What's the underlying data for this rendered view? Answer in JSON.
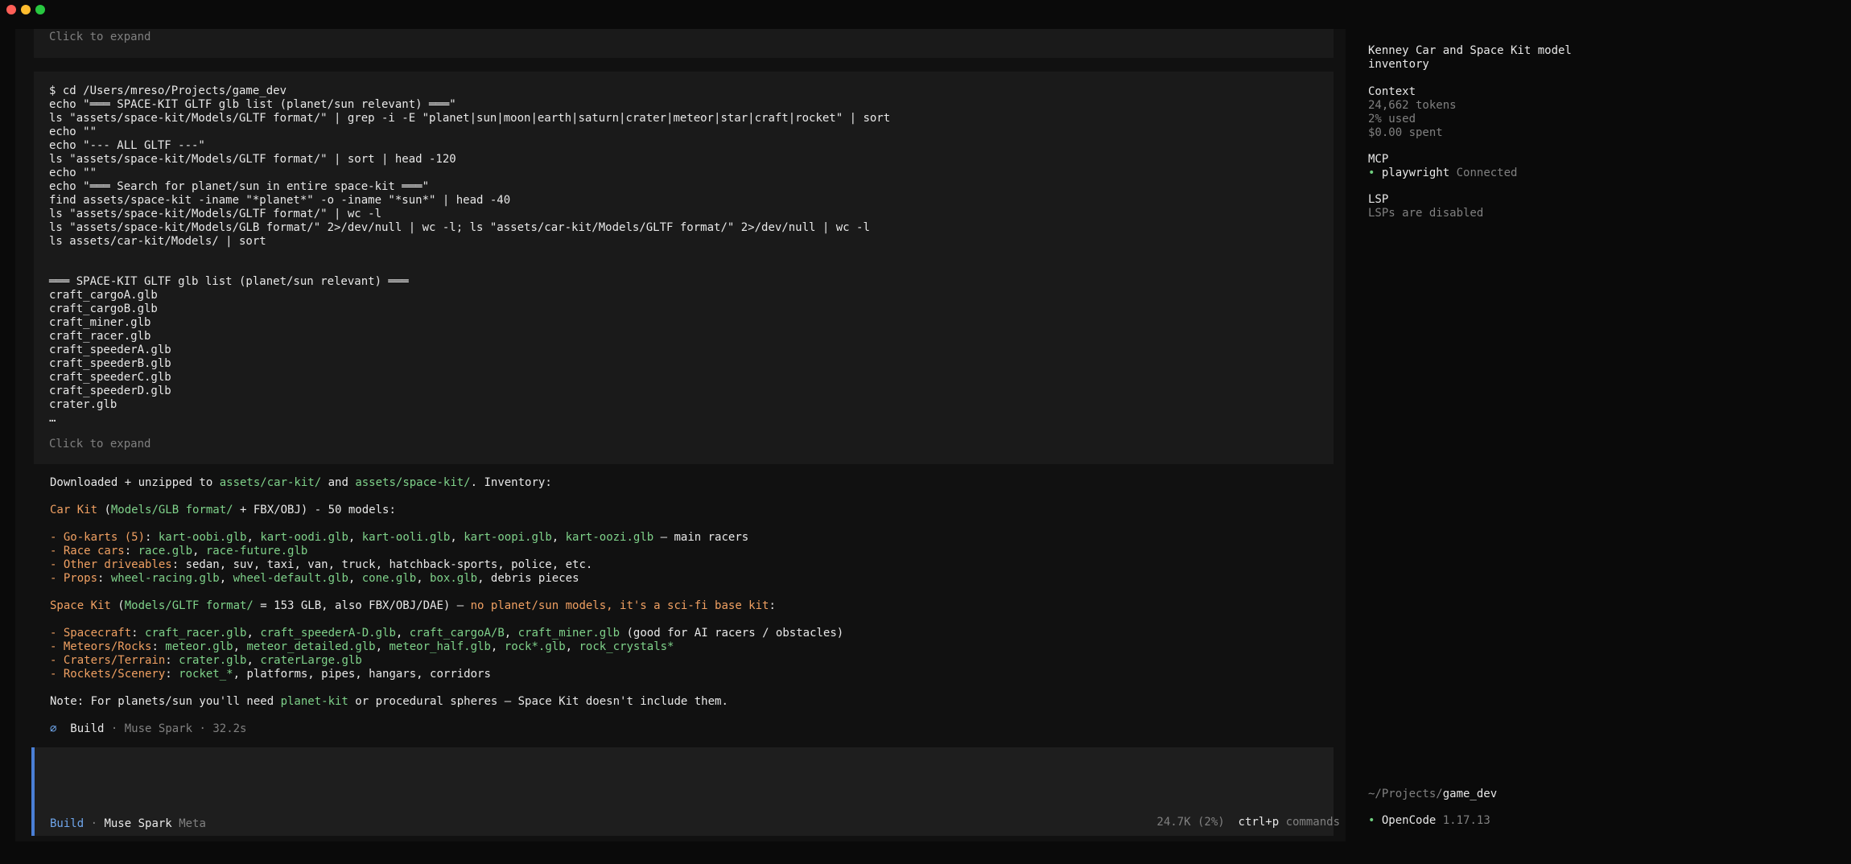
{
  "collapsed_block": {
    "expand_label": "Click to expand"
  },
  "tool_block": {
    "command_lines": [
      "$ cd /Users/mreso/Projects/game_dev",
      "echo \"═══ SPACE-KIT GLTF glb list (planet/sun relevant) ═══\"",
      "ls \"assets/space-kit/Models/GLTF format/\" | grep -i -E \"planet|sun|moon|earth|saturn|crater|meteor|star|craft|rocket\" | sort",
      "echo \"\"",
      "echo \"--- ALL GLTF ---\"",
      "ls \"assets/space-kit/Models/GLTF format/\" | sort | head -120",
      "echo \"\"",
      "echo \"═══ Search for planet/sun in entire space-kit ═══\"",
      "find assets/space-kit -iname \"*planet*\" -o -iname \"*sun*\" | head -40",
      "ls \"assets/space-kit/Models/GLTF format/\" | wc -l",
      "ls \"assets/space-kit/Models/GLB format/\" 2>/dev/null | wc -l; ls \"assets/car-kit/Models/GLTF format/\" 2>/dev/null | wc -l",
      "ls assets/car-kit/Models/ | sort"
    ],
    "output_lines": [
      "═══ SPACE-KIT GLTF glb list (planet/sun relevant) ═══",
      "craft_cargoA.glb",
      "craft_cargoB.glb",
      "craft_miner.glb",
      "craft_racer.glb",
      "craft_speederA.glb",
      "craft_speederB.glb",
      "craft_speederC.glb",
      "craft_speederD.glb",
      "crater.glb",
      "…"
    ],
    "expand_label": "Click to expand"
  },
  "assistant": {
    "intro": {
      "a": "Downloaded + unzipped to ",
      "b": "assets/car-kit/",
      "c": " and ",
      "d": "assets/space-kit/",
      "e": ". Inventory:"
    },
    "car_kit": {
      "title": "Car Kit",
      "a": " (",
      "path": "Models/GLB format/",
      "b": " + FBX/OBJ) - 50 models:"
    },
    "car_items": [
      {
        "label": "- Go-karts (5)",
        "sep": ": ",
        "parts": [
          {
            "t": "kart-oobi.glb",
            "c": "green"
          },
          {
            "t": ", ",
            "c": "white"
          },
          {
            "t": "kart-oodi.glb",
            "c": "green"
          },
          {
            "t": ", ",
            "c": "white"
          },
          {
            "t": "kart-ooli.glb",
            "c": "green"
          },
          {
            "t": ", ",
            "c": "white"
          },
          {
            "t": "kart-oopi.glb",
            "c": "green"
          },
          {
            "t": ", ",
            "c": "white"
          },
          {
            "t": "kart-oozi.glb",
            "c": "green"
          },
          {
            "t": " — main racers",
            "c": "white"
          }
        ]
      },
      {
        "label": "- Race cars",
        "sep": ": ",
        "parts": [
          {
            "t": "race.glb",
            "c": "green"
          },
          {
            "t": ", ",
            "c": "white"
          },
          {
            "t": "race-future.glb",
            "c": "green"
          }
        ]
      },
      {
        "label": "- Other driveables",
        "sep": ": ",
        "parts": [
          {
            "t": "sedan, suv, taxi, van, truck, hatchback-sports, police, etc.",
            "c": "white"
          }
        ]
      },
      {
        "label": "- Props",
        "sep": ": ",
        "parts": [
          {
            "t": "wheel-racing.glb",
            "c": "green"
          },
          {
            "t": ", ",
            "c": "white"
          },
          {
            "t": "wheel-default.glb",
            "c": "green"
          },
          {
            "t": ", ",
            "c": "white"
          },
          {
            "t": "cone.glb",
            "c": "green"
          },
          {
            "t": ", ",
            "c": "white"
          },
          {
            "t": "box.glb",
            "c": "green"
          },
          {
            "t": ", debris pieces",
            "c": "white"
          }
        ]
      }
    ],
    "space_kit": {
      "title": "Space Kit",
      "a": " (",
      "path": "Models/GLTF format/",
      "b": " = 153 GLB, also FBX/OBJ/DAE) — ",
      "warn": "no planet/sun models, it's a sci-fi base kit",
      "c": ":"
    },
    "space_items": [
      {
        "label": "- Spacecraft",
        "sep": ": ",
        "parts": [
          {
            "t": "craft_racer.glb",
            "c": "green"
          },
          {
            "t": ", ",
            "c": "white"
          },
          {
            "t": "craft_speederA-D.glb",
            "c": "green"
          },
          {
            "t": ", ",
            "c": "white"
          },
          {
            "t": "craft_cargoA/B",
            "c": "green"
          },
          {
            "t": ", ",
            "c": "white"
          },
          {
            "t": "craft_miner.glb",
            "c": "green"
          },
          {
            "t": " (good for AI racers / obstacles)",
            "c": "white"
          }
        ]
      },
      {
        "label": "- Meteors/Rocks",
        "sep": ": ",
        "parts": [
          {
            "t": "meteor.glb",
            "c": "green"
          },
          {
            "t": ", ",
            "c": "white"
          },
          {
            "t": "meteor_detailed.glb",
            "c": "green"
          },
          {
            "t": ", ",
            "c": "white"
          },
          {
            "t": "meteor_half.glb",
            "c": "green"
          },
          {
            "t": ", ",
            "c": "white"
          },
          {
            "t": "rock*.glb",
            "c": "green"
          },
          {
            "t": ", ",
            "c": "white"
          },
          {
            "t": "rock_crystals*",
            "c": "green"
          }
        ]
      },
      {
        "label": "- Craters/Terrain",
        "sep": ": ",
        "parts": [
          {
            "t": "crater.glb",
            "c": "green"
          },
          {
            "t": ", ",
            "c": "white"
          },
          {
            "t": "craterLarge.glb",
            "c": "green"
          }
        ]
      },
      {
        "label": "- Rockets/Scenery",
        "sep": ": ",
        "parts": [
          {
            "t": "rocket_*",
            "c": "green"
          },
          {
            "t": ", platforms, pipes, hangars, corridors",
            "c": "white"
          }
        ]
      }
    ],
    "note": {
      "a": "Note: For planets/sun you'll need ",
      "b": "planet-kit",
      "c": " or procedural spheres — Space Kit doesn't include them."
    },
    "footer": {
      "glyph": "⌀",
      "mode": "Build",
      "sep": " · ",
      "model": "Muse Spark",
      "sep2": " · ",
      "time": "32.2s"
    }
  },
  "input": {
    "mode": "Build",
    "sep": " · ",
    "model": "Muse Spark",
    "provider": "Meta"
  },
  "status": {
    "tokens": "24.7K (2%)",
    "shortcut": "ctrl+p",
    "shortcut_label": "commands"
  },
  "sidebar": {
    "title_line1": "Kenney Car and Space Kit model",
    "title_line2": "inventory",
    "context_heading": "Context",
    "context_tokens": "24,662 tokens",
    "context_used": "2% used",
    "context_spent": "$0.00 spent",
    "mcp_heading": "MCP",
    "mcp_server": "playwright",
    "mcp_status": "Connected",
    "lsp_heading": "LSP",
    "lsp_status": "LSPs are disabled",
    "path_prefix": "~/Projects/",
    "path_dir": "game_dev",
    "app_name": "OpenCode",
    "app_version": "1.17.13",
    "bullet": "•"
  },
  "colors": {
    "accent": "#4a7fd6",
    "path": "#7fd28a",
    "heading": "#f0a062",
    "status_dot": "#6fcf7f"
  }
}
